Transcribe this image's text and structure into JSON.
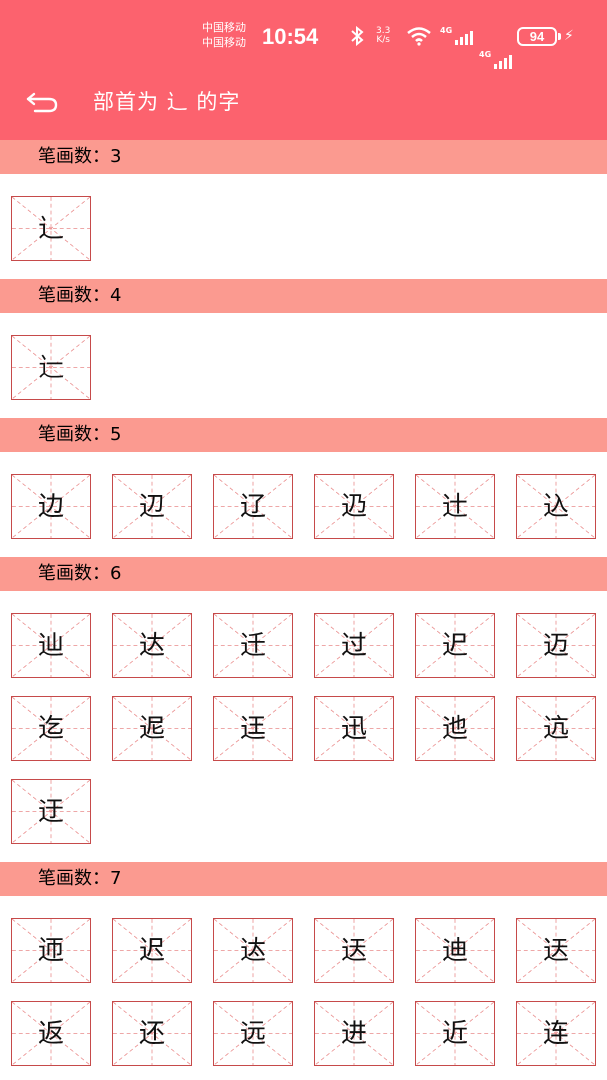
{
  "status": {
    "carrier1": "中国移动",
    "carrier2": "中国移动",
    "time": "10:54",
    "speed_value": "3.3",
    "speed_unit": "K/s",
    "net1": "4G",
    "net2": "4G",
    "battery": "94"
  },
  "header": {
    "title": "部首为 辶 的字"
  },
  "sections": [
    {
      "label": "笔画数：3",
      "chars": [
        "辶"
      ]
    },
    {
      "label": "笔画数：4",
      "chars": [
        "辷"
      ]
    },
    {
      "label": "笔画数：5",
      "chars": [
        "边",
        "辺",
        "辽",
        "辸",
        "辻",
        "込"
      ]
    },
    {
      "label": "笔画数：6",
      "chars": [
        "辿",
        "达",
        "迁",
        "过",
        "迉",
        "迈",
        "迄",
        "迡",
        "迋",
        "迅",
        "迆",
        "迒",
        "迂"
      ]
    },
    {
      "label": "笔画数：7",
      "chars": [
        "迊",
        "迟",
        "迏",
        "迗",
        "迪",
        "迗",
        "返",
        "还",
        "远",
        "进",
        "近",
        "连"
      ]
    }
  ],
  "colors": {
    "header": "#fc626e",
    "section": "#fb9a90",
    "cell_border": "#c64a4a",
    "guide": "#e98a8a"
  }
}
